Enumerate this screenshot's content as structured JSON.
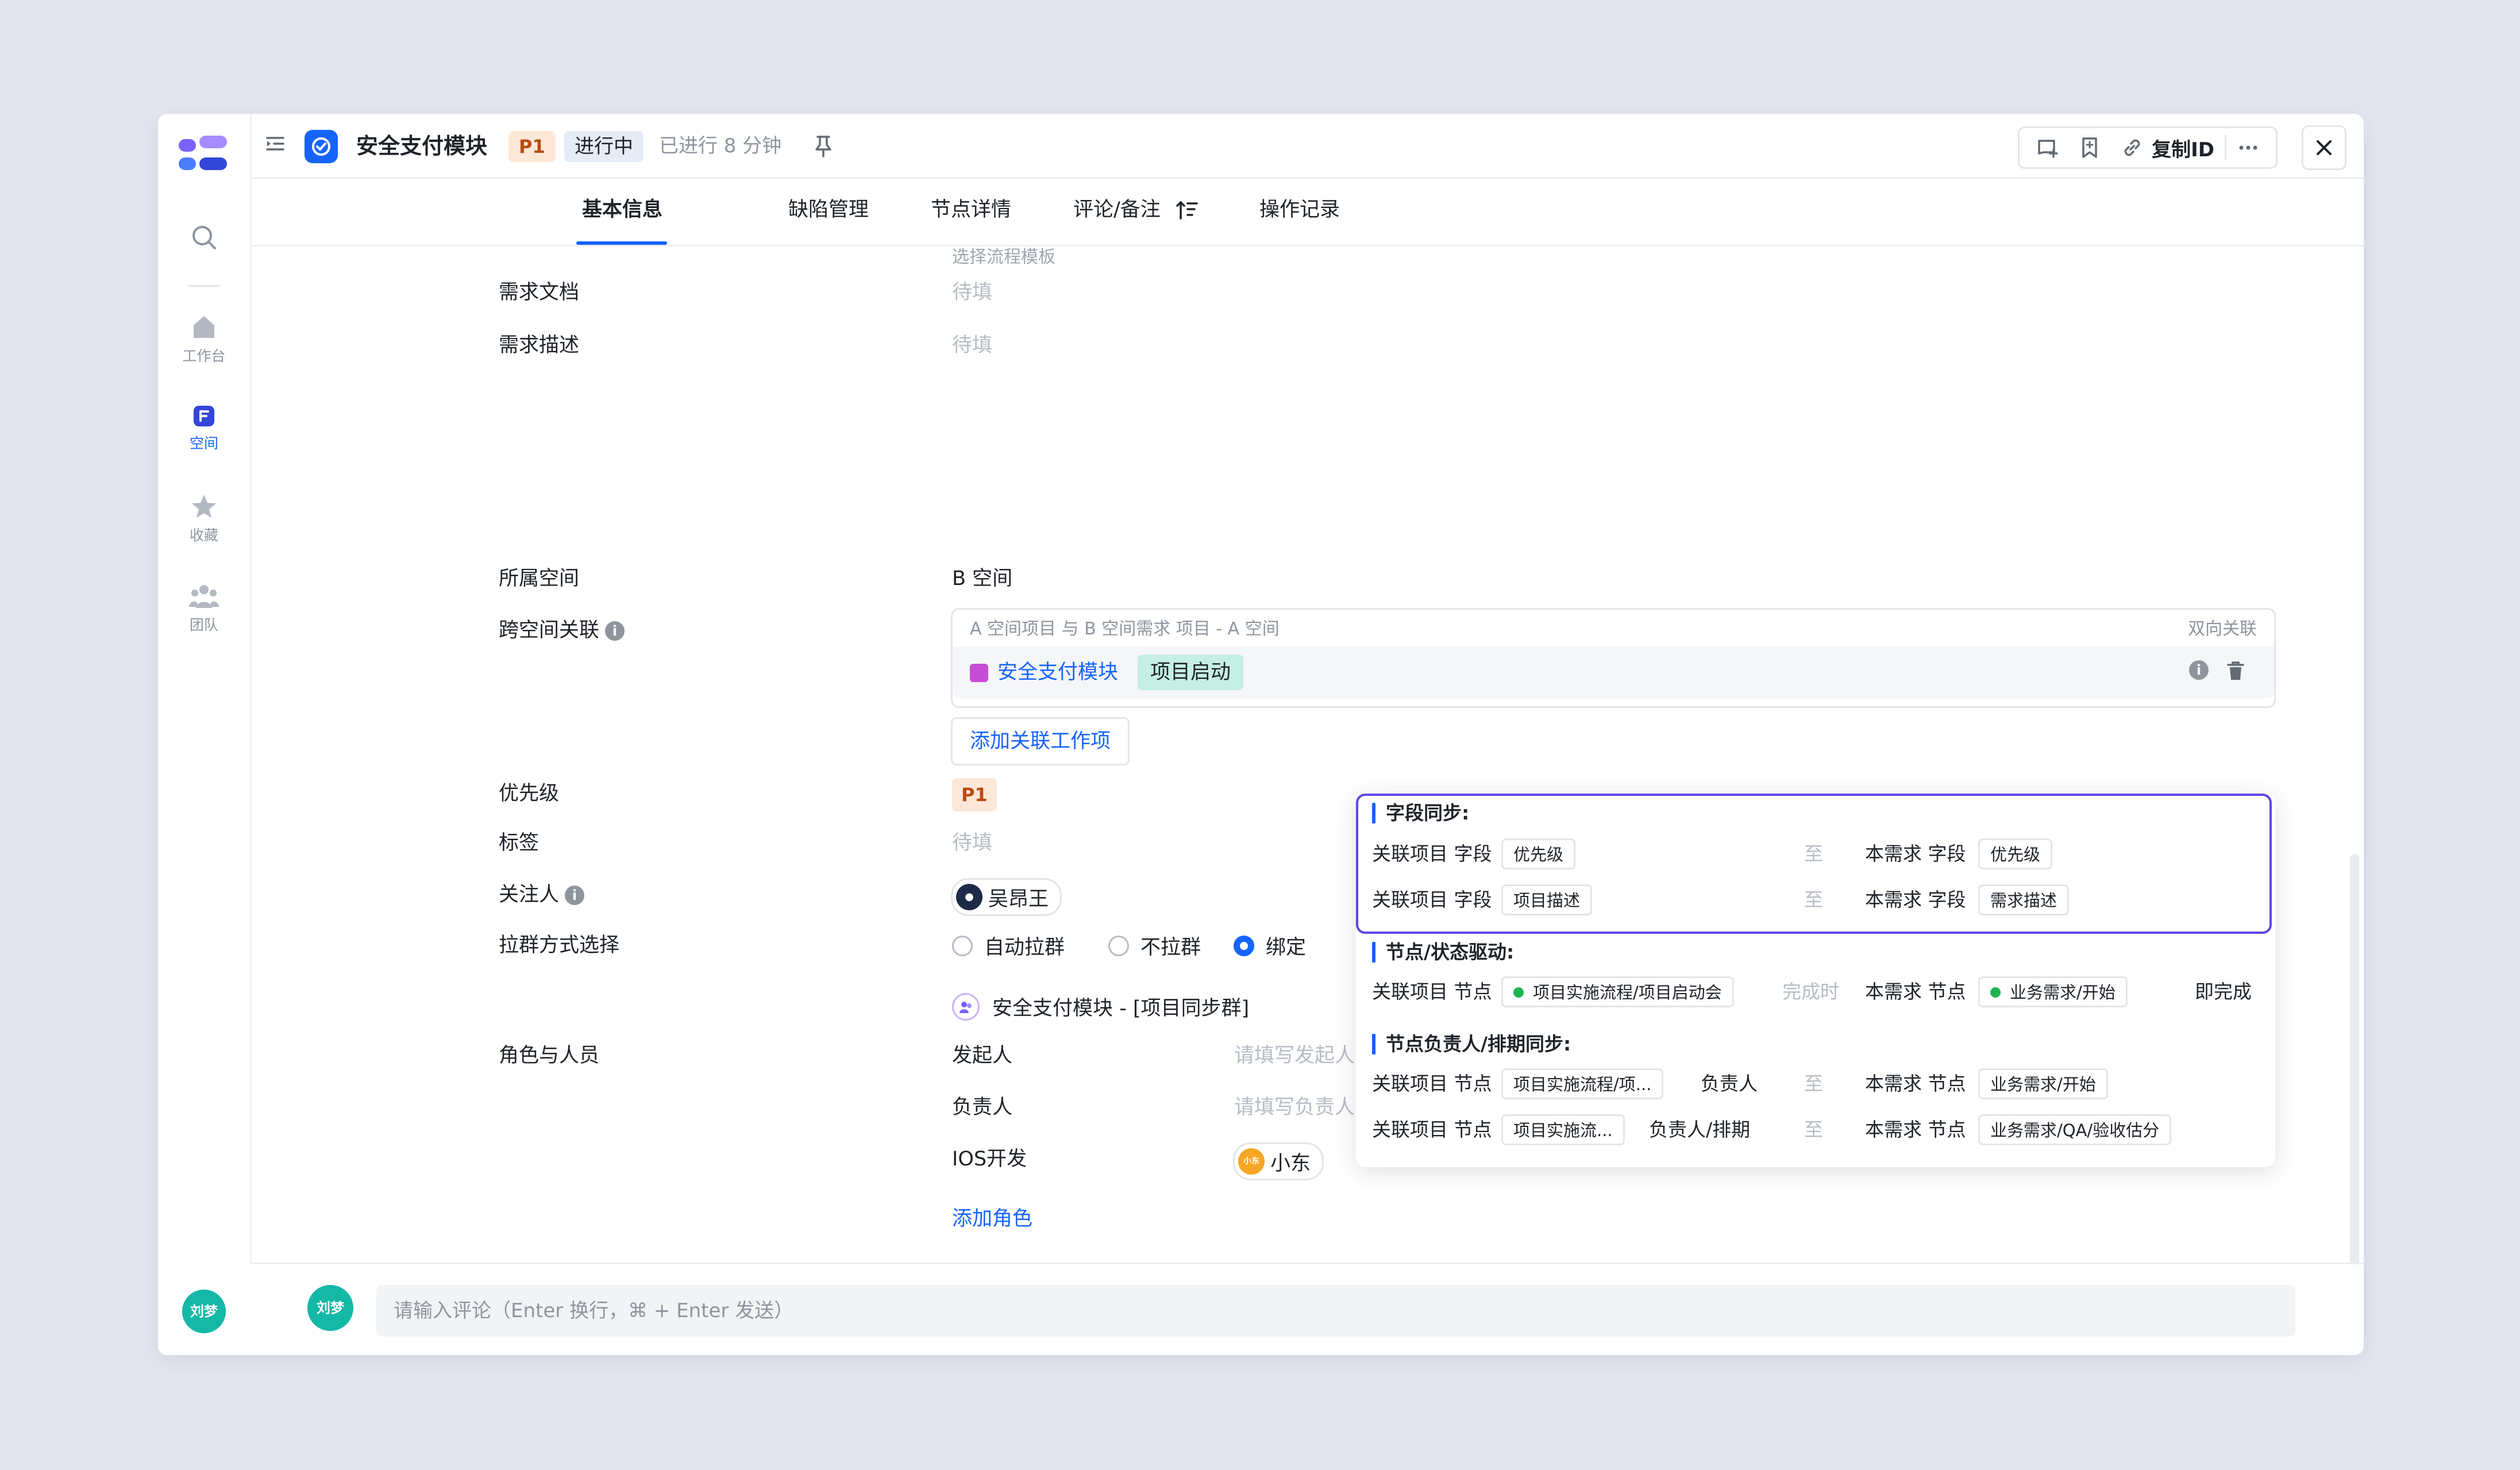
{
  "rail": {
    "items": [
      {
        "label": "工作台",
        "icon": "home-icon"
      },
      {
        "label": "空间",
        "icon": "space-icon",
        "active": true
      },
      {
        "label": "收藏",
        "icon": "star-icon"
      },
      {
        "label": "团队",
        "icon": "team-icon"
      }
    ],
    "user_avatar": "刘梦"
  },
  "header": {
    "title": "安全支付模块",
    "priority": "P1",
    "status": "进行中",
    "elapsed": "已进行 8 分钟",
    "copy_id": "复制ID"
  },
  "tabs": [
    {
      "label": "基本信息",
      "active": true
    },
    {
      "label": "缺陷管理"
    },
    {
      "label": "节点详情"
    },
    {
      "label": "评论/备注"
    },
    {
      "label": "操作记录"
    }
  ],
  "form": {
    "template_hint": "选择流程模板",
    "req_doc_label": "需求文档",
    "req_doc_value": "待填",
    "req_desc_label": "需求描述",
    "req_desc_value": "待填",
    "space_label": "所属空间",
    "space_value": "B 空间",
    "cross_label": "跨空间关联",
    "cross_header": "A 空间项目 与 B 空间需求  项目 - A 空间",
    "cross_mode": "双向关联",
    "cross_project": "安全支付模块",
    "cross_stage": "项目启动",
    "add_link": "添加关联工作项",
    "priority_label": "优先级",
    "priority_value": "P1",
    "tags_label": "标签",
    "tags_value": "待填",
    "watcher_label": "关注人",
    "watcher_name": "吴昂王",
    "group_label": "拉群方式选择",
    "group_options": [
      "自动拉群",
      "不拉群",
      "绑定"
    ],
    "group_selected": 2,
    "group_name": "安全支付模块 - [项目同步群]",
    "roles_label": "角色与人员",
    "roles": [
      {
        "role": "发起人",
        "value": "请填写发起人",
        "placeholder": true
      },
      {
        "role": "负责人",
        "value": "请填写负责人",
        "placeholder": true
      },
      {
        "role": "IOS开发",
        "value": "小东",
        "placeholder": false
      }
    ],
    "add_role": "添加角色"
  },
  "popover": {
    "field_sync_title": "字段同步:",
    "field_rows": [
      {
        "left": "关联项目 字段",
        "left_chip": "优先级",
        "to": "至",
        "right": "本需求 字段",
        "right_chip": "优先级"
      },
      {
        "left": "关联项目 字段",
        "left_chip": "项目描述",
        "to": "至",
        "right": "本需求 字段",
        "right_chip": "需求描述"
      }
    ],
    "node_drive_title": "节点/状态驱动:",
    "node_drive": {
      "left": "关联项目 节点",
      "left_chip": "项目实施流程/项目启动会",
      "when": "完成时",
      "right": "本需求 节点",
      "right_chip": "业务需求/开始",
      "action": "即完成"
    },
    "owner_sync_title": "节点负责人/排期同步:",
    "owner_rows": [
      {
        "left": "关联项目 节点",
        "left_chip": "项目实施流程/项...",
        "what": "负责人",
        "to": "至",
        "right": "本需求 节点",
        "right_chip": "业务需求/开始"
      },
      {
        "left": "关联项目 节点",
        "left_chip": "项目实施流...",
        "what": "负责人/排期",
        "to": "至",
        "right": "本需求 节点",
        "right_chip": "业务需求/QA/验收估分"
      }
    ]
  },
  "footer": {
    "avatar": "刘梦",
    "comment_placeholder": "请输入评论（Enter 换行，⌘ + Enter 发送）"
  },
  "colors": {
    "accent": "#1664ff",
    "popover_border": "#6046e5",
    "avatar_green": "#14b8a6",
    "priority_bg": "#fde7d7"
  }
}
